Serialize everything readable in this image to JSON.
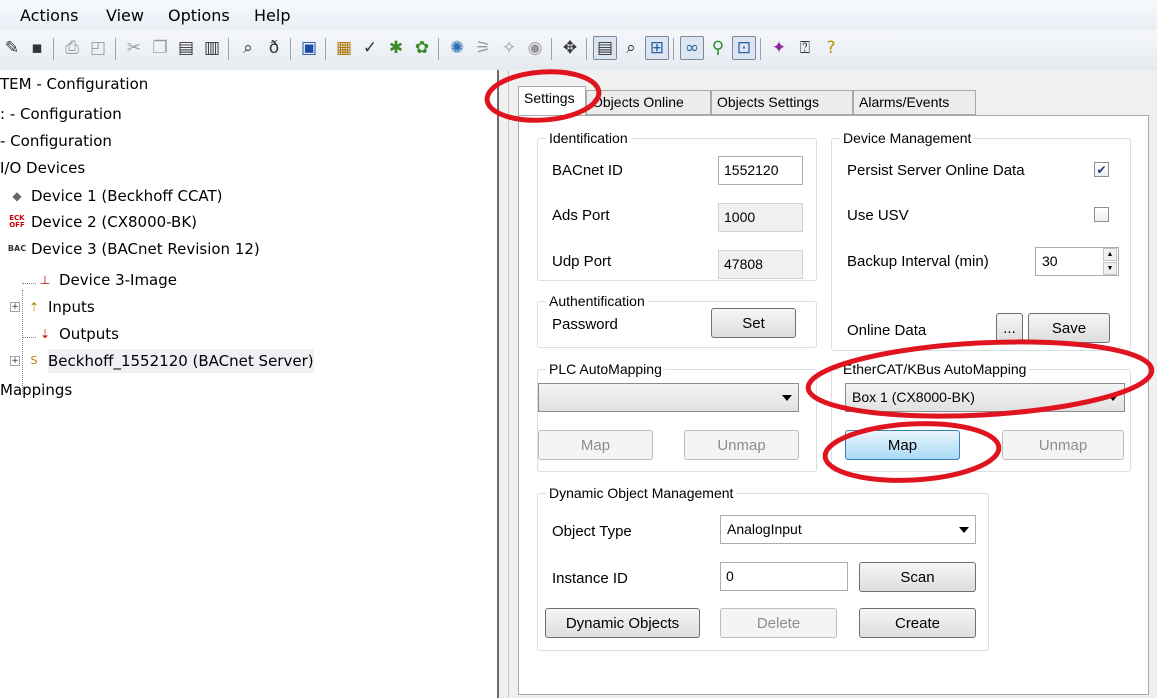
{
  "menu": {
    "items": [
      "Actions",
      "View",
      "Options",
      "Help"
    ]
  },
  "toolbar": {
    "icons": [
      "new-icon",
      "save-icon",
      "print-icon",
      "print-preview-icon",
      "cut-icon",
      "copy-icon",
      "paste-icon",
      "paste-with-links-icon",
      "find-icon",
      "find-next-icon",
      "monitor-icon",
      "generate-mappings-icon",
      "check-configuration-icon",
      "activate-configuration-icon",
      "restart-run-mode-icon",
      "reload-devices-icon",
      "scan-devices-icon",
      "toggle-free-run-icon",
      "target-system-icon",
      "show-online-data-icon",
      "zoom-icon",
      "plc-project-icon",
      "show-sub-items-icon",
      "online-watch-icon",
      "io-link-icon",
      "bookmark-icon",
      "help-icon",
      "whats-this-icon"
    ]
  },
  "tree": {
    "items": [
      {
        "label": "TEM - Configuration"
      },
      {
        "label": ": - Configuration"
      },
      {
        "label": "- Configuration"
      },
      {
        "label": "I/O Devices"
      },
      {
        "label": "Device 1 (Beckhoff CCAT)"
      },
      {
        "label": "Device 2 (CX8000-BK)",
        "icon_text": "ECK\nOFF"
      },
      {
        "label": "Device 3 (BACnet Revision 12)",
        "icon_text": "BAC"
      },
      {
        "label": "Device 3-Image"
      },
      {
        "label": "Inputs"
      },
      {
        "label": "Outputs"
      },
      {
        "label": "Beckhoff_1552120 (BACnet Server)",
        "icon_text": "S"
      },
      {
        "label": "Mappings"
      }
    ]
  },
  "tabs": [
    "Settings",
    "Objects Online",
    "Objects Settings",
    "Alarms/Events"
  ],
  "identification": {
    "title": "Identification",
    "bacnet_id_label": "BACnet ID",
    "bacnet_id": "1552120",
    "ads_port_label": "Ads Port",
    "ads_port": "1000",
    "udp_port_label": "Udp Port",
    "udp_port": "47808"
  },
  "device_management": {
    "title": "Device Management",
    "persist_label": "Persist Server Online Data",
    "persist_checked": true,
    "use_usv_label": "Use USV",
    "use_usv_checked": false,
    "backup_label": "Backup Interval (min)",
    "backup_value": "30",
    "online_data_label": "Online Data",
    "browse_label": "...",
    "save_label": "Save"
  },
  "authentification": {
    "title": "Authentification",
    "password_label": "Password",
    "set_label": "Set"
  },
  "plc_automapping": {
    "title": "PLC AutoMapping",
    "selected": "",
    "map_label": "Map",
    "unmap_label": "Unmap"
  },
  "ethercat_automapping": {
    "title": "EtherCAT/KBus AutoMapping",
    "selected": "Box 1 (CX8000-BK)",
    "map_label": "Map",
    "unmap_label": "Unmap"
  },
  "dynamic_objects": {
    "title": "Dynamic Object Management",
    "object_type_label": "Object Type",
    "object_type": "AnalogInput",
    "instance_id_label": "Instance ID",
    "instance_id": "0",
    "scan_label": "Scan",
    "dynamic_objects_label": "Dynamic Objects",
    "delete_label": "Delete",
    "create_label": "Create"
  },
  "colors": {
    "highlight_ellipse": "#e0141e",
    "selection_blue": "#a7d9f5"
  }
}
